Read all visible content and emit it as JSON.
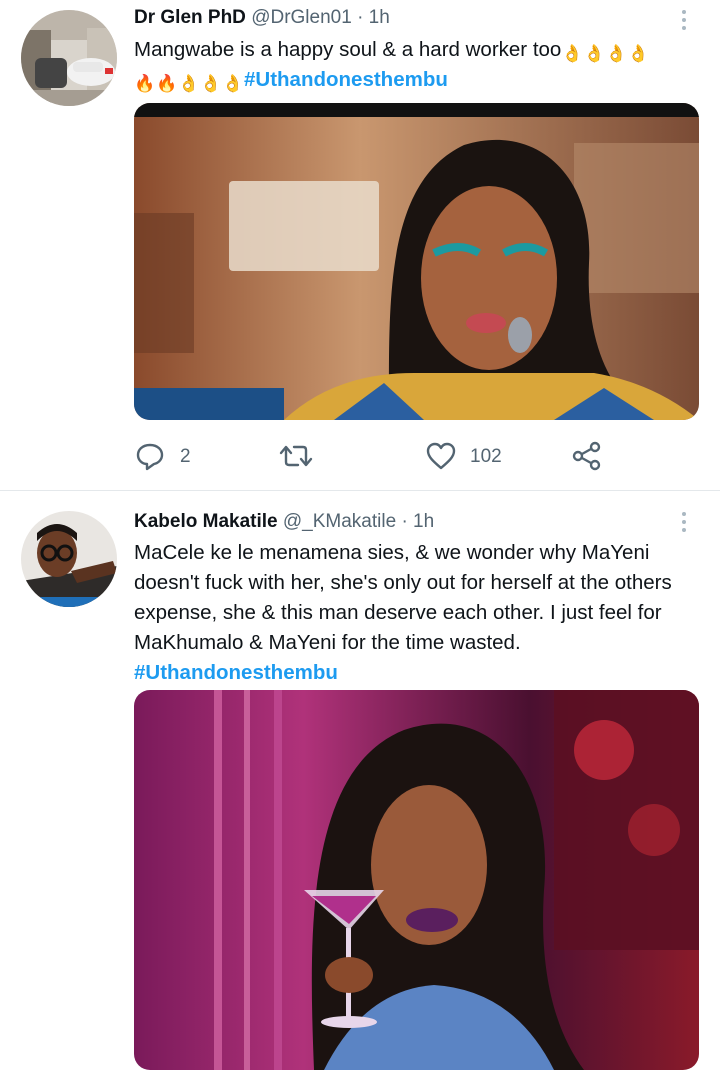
{
  "tweets": [
    {
      "name": "Dr Glen PhD",
      "handle": "@DrGlen01",
      "time": "· 1h",
      "line1": "Mangwabe is a happy soul & a hard worker too",
      "emoji_ok": "👌",
      "emoji_fire": "🔥",
      "hashtag": "#Uthandonesthembu",
      "replies": "2",
      "likes": "102"
    },
    {
      "name": "Kabelo Makatile",
      "handle": "@_KMakatile",
      "time": "· 1h",
      "text": "MaCele ke le menamena sies, & we wonder why MaYeni doesn't fuck with her, she's only out for herself at the others expense, she & this man deserve each other. I just feel for MaKhumalo & MaYeni for the time wasted.",
      "hashtag": "#Uthandonesthembu"
    }
  ],
  "colors": {
    "accent": "#1d9bf0",
    "meta": "#536471",
    "divider": "#e4e8eb"
  },
  "icons": [
    "more-icon",
    "reply-icon",
    "retweet-icon",
    "like-icon",
    "share-icon"
  ]
}
